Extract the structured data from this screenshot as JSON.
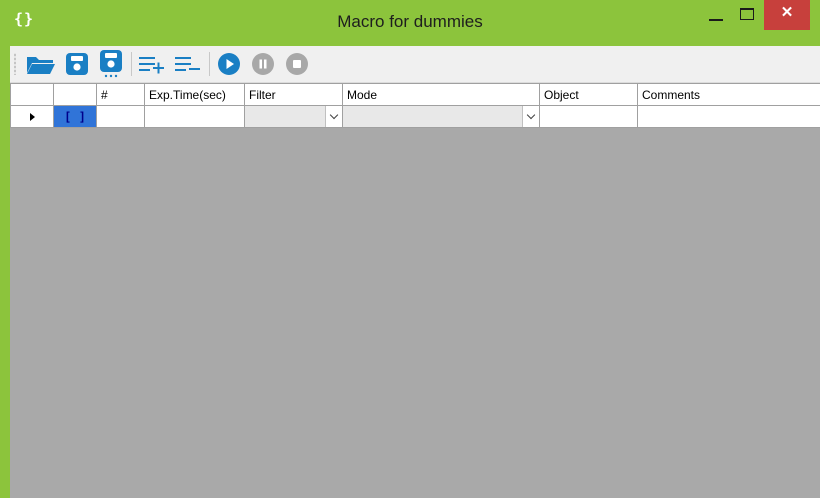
{
  "window": {
    "app_icon": "{}",
    "title": "Macro for dummies",
    "close_glyph": "✕"
  },
  "toolbar": {
    "items": [
      {
        "name": "open-folder-icon",
        "color": "#1a7fc4"
      },
      {
        "name": "save-icon",
        "color": "#1a7fc4"
      },
      {
        "name": "save-as-icon",
        "color": "#1a7fc4"
      },
      {
        "name": "add-row-icon",
        "color": "#1a7fc4"
      },
      {
        "name": "remove-row-icon",
        "color": "#1a7fc4"
      },
      {
        "name": "play-icon",
        "color": "#1a7fc4"
      },
      {
        "name": "pause-icon",
        "color": "#a8a8a8"
      },
      {
        "name": "stop-icon",
        "color": "#a8a8a8"
      }
    ]
  },
  "grid": {
    "columns": [
      "",
      "#",
      "Exp.Time(sec)",
      "Filter",
      "Mode",
      "Object",
      "Comments"
    ],
    "rows": [
      {
        "cell0": "[ ]",
        "number": "",
        "exp_time": "",
        "filter": "",
        "mode": "",
        "object": "",
        "comments": ""
      }
    ]
  },
  "colors": {
    "frame": "#8cc43c",
    "close_button": "#c7403c",
    "grid_background": "#a9a9a9",
    "selection": "#3074d8"
  }
}
